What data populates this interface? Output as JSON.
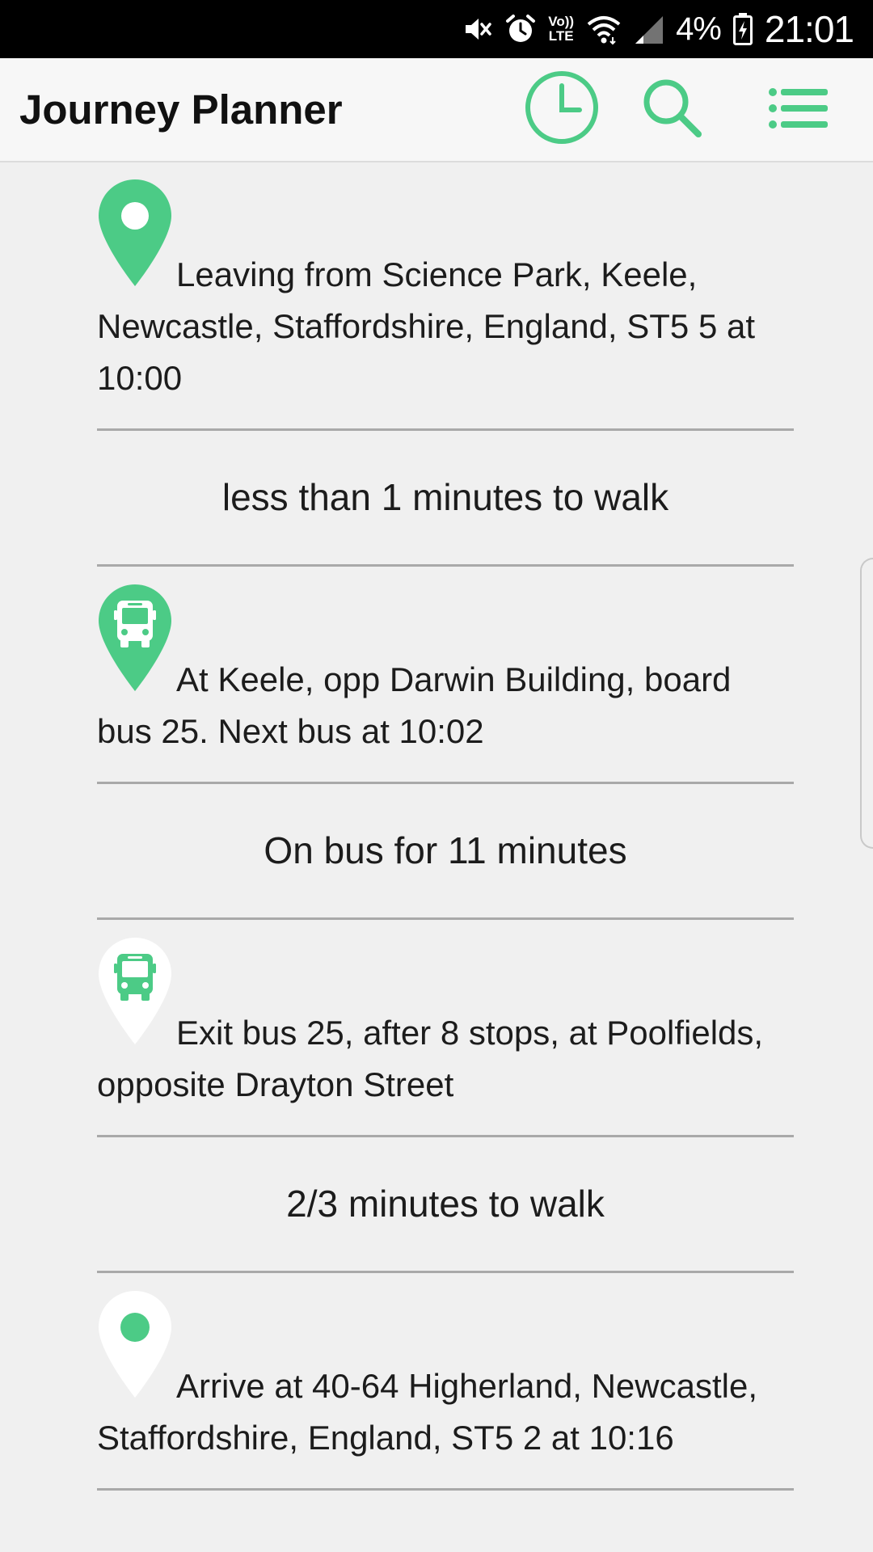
{
  "status_bar": {
    "battery_percent": "4%",
    "time": "21:01",
    "volte_line1": "Vo))",
    "volte_line2": "LTE",
    "icons": [
      "mute-icon",
      "alarm-icon",
      "volte-icon",
      "wifi-icon",
      "signal-icon",
      "battery-charging-icon"
    ]
  },
  "app_bar": {
    "title": "Journey Planner",
    "actions": [
      "clock-icon",
      "search-icon",
      "list-menu-icon"
    ],
    "accent_color": "#4ccb86"
  },
  "journey": {
    "steps": [
      {
        "kind": "stop",
        "icon": "location-pin-icon",
        "pin_style": "filled",
        "text": "Leaving from Science Park, Keele, Newcastle, Staffordshire, England, ST5 5 at 10:00"
      },
      {
        "kind": "travel",
        "text": "less than 1 minutes to walk"
      },
      {
        "kind": "stop",
        "icon": "bus-pin-icon",
        "pin_style": "filled",
        "text": "At Keele, opp Darwin Building, board bus 25. Next bus at 10:02"
      },
      {
        "kind": "travel",
        "text": "On bus for 11 minutes"
      },
      {
        "kind": "stop",
        "icon": "bus-pin-icon",
        "pin_style": "outline",
        "text": "Exit bus 25, after 8 stops, at Poolfields, opposite Drayton Street"
      },
      {
        "kind": "travel",
        "text": "2/3 minutes to walk"
      },
      {
        "kind": "stop",
        "icon": "destination-pin-icon",
        "pin_style": "outline",
        "text": "Arrive at 40-64 Higherland, Newcastle, Staffordshire, England, ST5 2 at 10:16"
      }
    ]
  }
}
